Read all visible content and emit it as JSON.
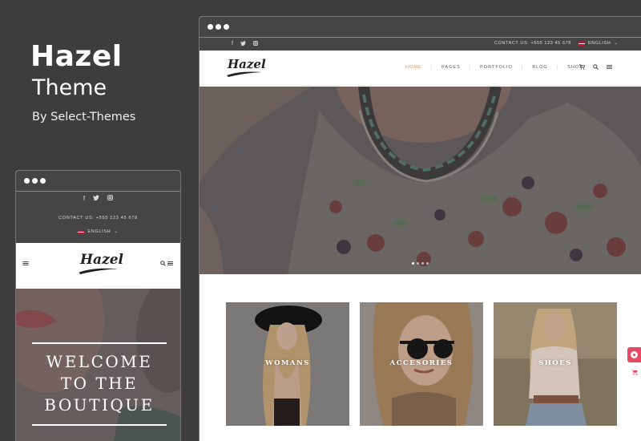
{
  "brand": {
    "title": "Hazel",
    "subtitle": "Theme",
    "by": "By Select-Themes"
  },
  "desktop": {
    "contact": "CONTACT US: +555 123 45 678",
    "language": "ENGLISH",
    "logo": "Hazel",
    "nav": [
      {
        "label": "HOME",
        "active": true
      },
      {
        "label": "PAGES",
        "active": false
      },
      {
        "label": "PORTFOLIO",
        "active": false
      },
      {
        "label": "BLOG",
        "active": false
      },
      {
        "label": "SHOP",
        "active": false
      }
    ],
    "slider_dots": 4,
    "slider_active": 1,
    "categories": [
      {
        "label": "WOMANS"
      },
      {
        "label": "ACCESORIES"
      },
      {
        "label": "SHOES"
      }
    ]
  },
  "mobile": {
    "contact": "CONTACT US: +555 123 45 678",
    "language": "ENGLISH",
    "logo": "Hazel",
    "welcome": [
      "WELCOME",
      "TO THE",
      "BOUTIQUE"
    ]
  },
  "icons": {
    "social": [
      "facebook-icon",
      "twitter-icon",
      "instagram-icon"
    ],
    "header": [
      "cart-icon",
      "search-icon",
      "menu-icon"
    ]
  },
  "colors": {
    "background": "#3d3d3d",
    "topbar": "#454545",
    "nav_active": "#e38f5e",
    "widget": "#e84a63"
  }
}
